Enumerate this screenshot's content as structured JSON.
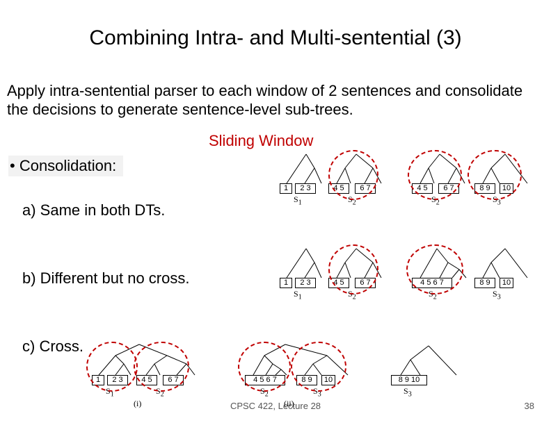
{
  "title": "Combining Intra- and Multi-sentential (3)",
  "body": "Apply intra-sentential parser to each window of 2 sentences and consolidate the decisions to generate sentence-level sub-trees.",
  "sliding_window": "Sliding Window",
  "bullet": "•   Consolidation:",
  "items": {
    "a": "a) Same in both DTs.",
    "b": "b) Different but no cross.",
    "c": "c) Cross."
  },
  "footer": {
    "center": "CPSC 422, Lecture 28",
    "right": "38"
  },
  "labels": {
    "s1": "S",
    "s2": "S",
    "s3": "S",
    "sub1": "1",
    "sub2": "2",
    "sub3": "3",
    "case_i": "(i)",
    "case_ii": "(ii)"
  },
  "leaves": {
    "l1": "1",
    "l23": "2 3",
    "l45": "4 5",
    "l67": "6 7",
    "l4567": "4 5  6 7",
    "l89": "8 9",
    "l10": "10",
    "l8910": "8 9 10"
  }
}
